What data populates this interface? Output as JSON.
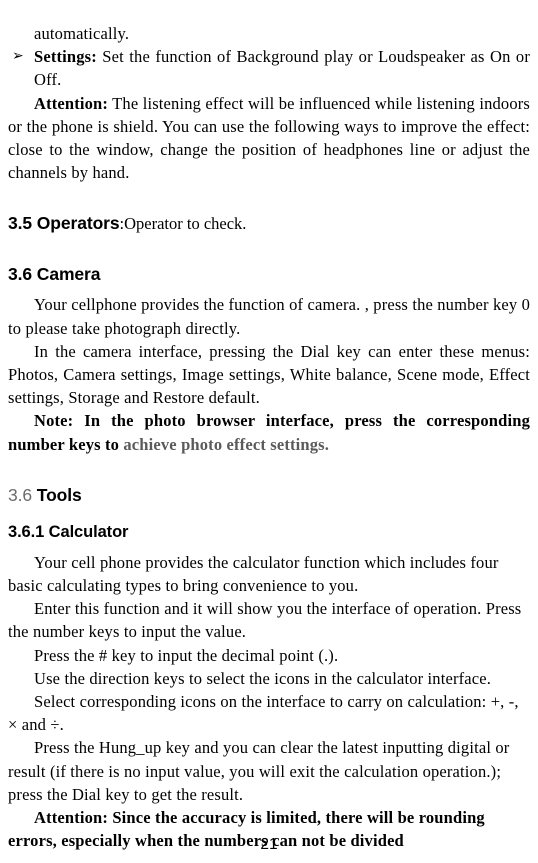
{
  "document": {
    "page_number": "21"
  },
  "content": {
    "continued_line": "automatically.",
    "settings_bullet": {
      "glyph": "arrowhead-bullet-icon",
      "glyph_char": "➢",
      "label": "Settings:",
      "text": " Set the function of Background play or Loudspeaker as On or Off."
    },
    "attention_audio": {
      "label": "Attention:",
      "text": " The listening effect will be influenced while listening indoors or the phone is shield. You can use the following ways to improve the effect: close to the window, change the position of headphones line or adjust the channels by hand."
    },
    "section_operators": {
      "heading": "3.5 Operators",
      "tail": ":Operator to check."
    },
    "section_camera": {
      "heading": "3.6 Camera",
      "para1": "Your cellphone provides the function of camera. ,    press the number key 0 to please take photograph directly.",
      "para2": "In the camera interface, pressing the Dial key can enter these menus: Photos, Camera settings, Image settings, White balance, Scene mode, Effect settings, Storage and Restore default.",
      "note_bold": "Note: In the photo browser interface, press the corresponding number keys to ",
      "note_gray": "achieve photo effect settings."
    },
    "section_tools": {
      "heading_number": "3.6",
      "heading_title": "Tools"
    },
    "section_calculator": {
      "heading": "3.6.1 Calculator",
      "para1": "Your cell phone provides the calculator function which includes four basic calculating types to bring convenience to you.",
      "para2": "Enter this function and it will show you the interface of operation. Press the number keys to input the value.",
      "para3": "Press the # key to input the decimal point (.).",
      "para4": "Use the direction keys to select the icons in the calculator interface.",
      "para5": "Select corresponding icons on the interface to carry on calculation: +, -, × and ÷.",
      "para6": "Press the Hung_up key and you can clear the latest inputting digital or result (if there is no input value, you will exit the calculation operation.); press the Dial key to get the result.",
      "attention": "Attention: Since the accuracy is limited, there will be rounding errors, especially when the numbers can not be divided"
    }
  }
}
